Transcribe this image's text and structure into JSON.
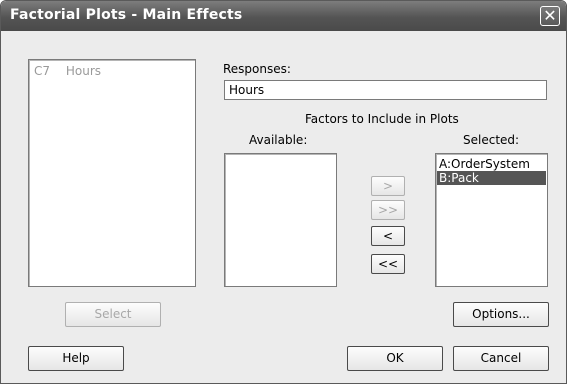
{
  "window": {
    "title": "Factorial Plots - Main Effects",
    "close_glyph": "✕"
  },
  "columns_list": {
    "items": [
      {
        "id": "C7",
        "name": "Hours"
      }
    ]
  },
  "responses": {
    "label": "Responses:",
    "value": "Hours"
  },
  "factors": {
    "heading": "Factors to Include in Plots",
    "available_label": "Available:",
    "selected_label": "Selected:",
    "selected_items": [
      "A:OrderSystem",
      "B:Pack"
    ],
    "highlighted_index": 1
  },
  "arrows": {
    "add": ">",
    "add_all": ">>",
    "remove": "<",
    "remove_all": "<<"
  },
  "buttons": {
    "select": "Select",
    "options": "Options...",
    "help": "Help",
    "ok": "OK",
    "cancel": "Cancel"
  }
}
